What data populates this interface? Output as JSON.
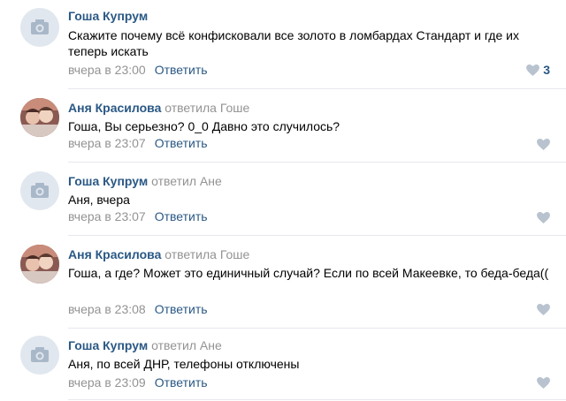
{
  "colors": {
    "link": "#2a5885",
    "muted": "#939393",
    "divider": "#e7e8ec",
    "avatar_placeholder": "#e1e7ee"
  },
  "comments": [
    {
      "author": "Гоша Купрум",
      "reply_to": "",
      "text": "Скажите почему всё конфисковали все золото в ломбардах Стандарт и где их теперь искать",
      "date": "вчера в 23:00",
      "reply_label": "Ответить",
      "likes": "3",
      "avatar_icon": "camera-icon"
    },
    {
      "author": "Аня Красилова",
      "reply_to": "ответила Гоше",
      "text": "Гоша, Вы серьезно? 0_0 Давно это случилось?",
      "date": "вчера в 23:07",
      "reply_label": "Ответить",
      "avatar_icon": "user-photo"
    },
    {
      "author": "Гоша Купрум",
      "reply_to": "ответил Ане",
      "text": "Аня, вчера",
      "date": "вчера в 23:07",
      "reply_label": "Ответить",
      "avatar_icon": "camera-icon"
    },
    {
      "author": "Аня Красилова",
      "reply_to": "ответила Гоше",
      "text": "Гоша, а где? Может это единичный случай? Если по всей Макеевке, то беда-беда((",
      "date": "вчера в 23:08",
      "reply_label": "Ответить",
      "avatar_icon": "user-photo"
    },
    {
      "author": "Гоша Купрум",
      "reply_to": "ответил Ане",
      "text": "Аня, по всей ДНР, телефоны отключены",
      "date": "вчера в 23:09",
      "reply_label": "Ответить",
      "avatar_icon": "camera-icon"
    }
  ]
}
